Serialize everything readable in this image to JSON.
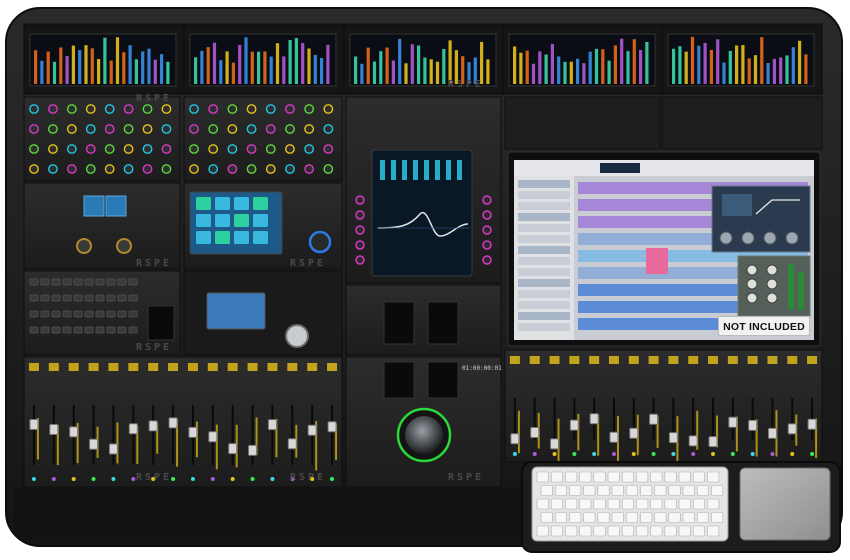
{
  "brand": "RSPE",
  "badge": "NOT INCLUDED",
  "timecode": "01:00:00:01",
  "colors": {
    "chassis": "#1b1b1b",
    "panel": "#262626",
    "meter_yellow": "#e8c21a",
    "meter_blue": "#3a8ee8",
    "meter_orange": "#e86a1a",
    "knob_ring_cyan": "#1ec8e8",
    "knob_ring_magenta": "#d838c8",
    "knob_ring_green": "#5cd83a",
    "touchscreen_cyan": "#39b8e0",
    "daw_waveform_blue": "#4a80d8",
    "daw_region_purple": "#a07ad8",
    "daw_region_pink": "#e86a9a"
  },
  "icons": {
    "keyboard": "keyboard-icon",
    "trackpad": "trackpad-icon",
    "jog_wheel": "jog-wheel-icon"
  }
}
